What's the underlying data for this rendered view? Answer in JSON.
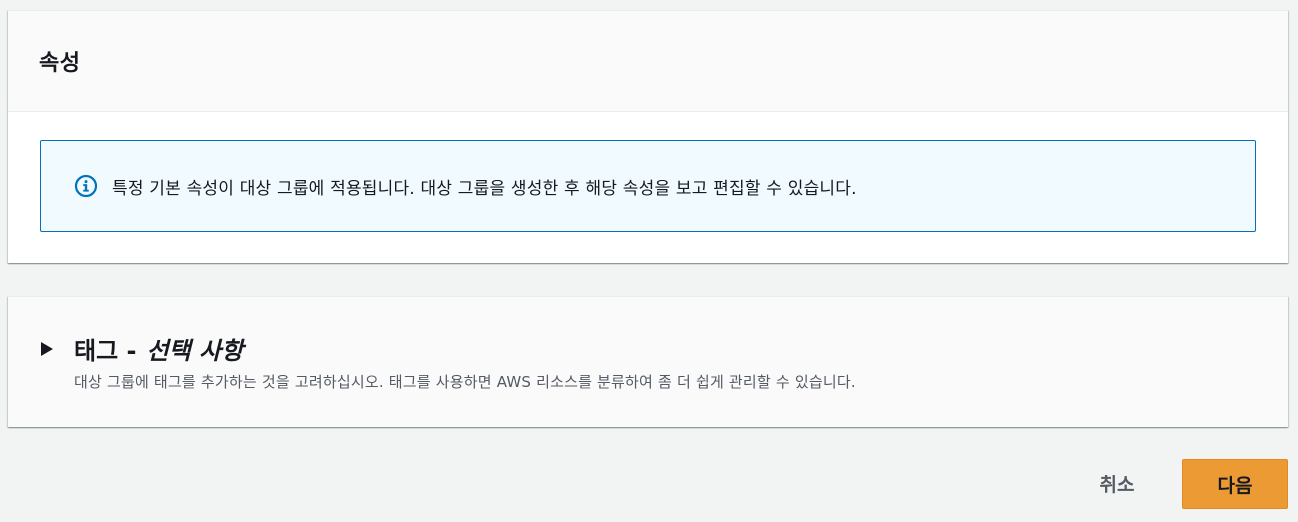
{
  "attributes": {
    "title": "속성",
    "info": {
      "icon": "info-icon",
      "text": "특정 기본 속성이 대상 그룹에 적용됩니다. 대상 그룹을 생성한 후 해당 속성을 보고 편집할 수 있습니다."
    }
  },
  "tags": {
    "icon": "caret-right-icon",
    "title": "태그 -",
    "optional": "선택 사항",
    "description": "대상 그룹에 태그를 추가하는 것을 고려하십시오. 태그를 사용하면 AWS 리소스를 분류하여 좀 더 쉽게 관리할 수 있습니다."
  },
  "footer": {
    "cancel_label": "취소",
    "next_label": "다음"
  },
  "colors": {
    "accent": "#ec9a33",
    "info_border": "#0073bb",
    "info_bg": "#f1faff"
  }
}
